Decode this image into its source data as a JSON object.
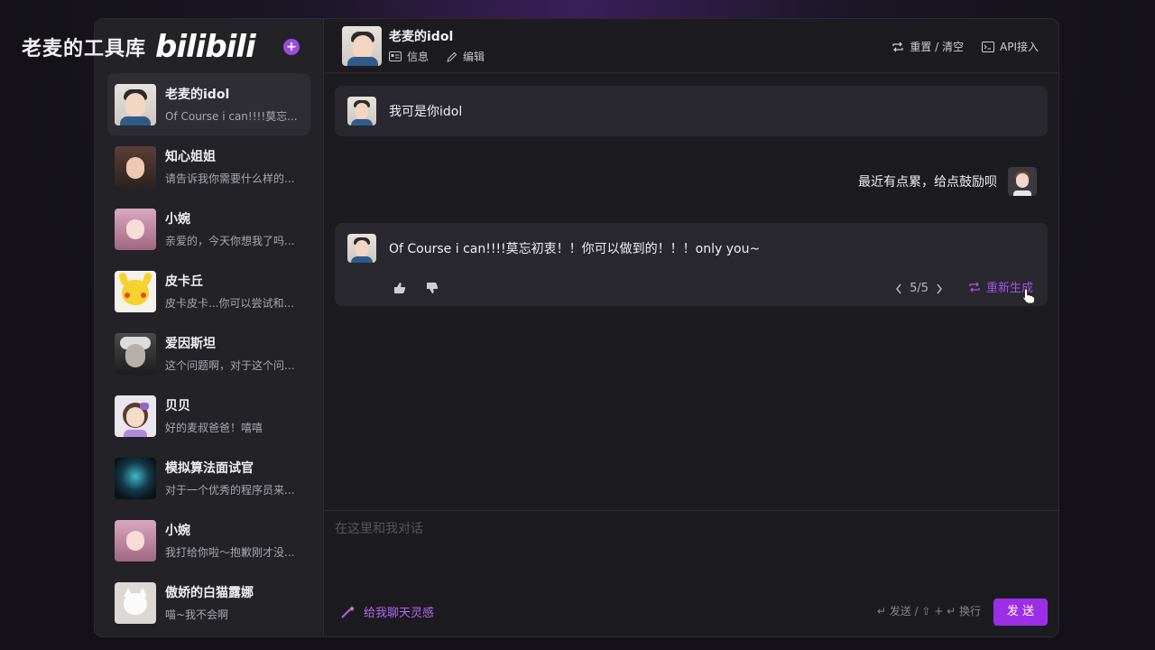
{
  "watermark": {
    "text": "老麦的工具库",
    "logo": "bilibili"
  },
  "sidebar": {
    "contacts": [
      {
        "name": "老麦的idol",
        "preview": "Of Course i can!!!!莫忘...",
        "avatar": "idol-avatar",
        "active": true
      },
      {
        "name": "知心姐姐",
        "preview": "请告诉我你需要什么样的...",
        "avatar": "sister-avatar"
      },
      {
        "name": "小婉",
        "preview": "亲爱的，今天你想我了吗...",
        "avatar": "anime-girl-avatar"
      },
      {
        "name": "皮卡丘",
        "preview": "皮卡皮卡...你可以尝试和...",
        "avatar": "pikachu-avatar"
      },
      {
        "name": "爱因斯坦",
        "preview": "这个问题啊，对于这个问...",
        "avatar": "einstein-avatar"
      },
      {
        "name": "贝贝",
        "preview": "好的麦叔爸爸！嘻嘻",
        "avatar": "beibei-avatar"
      },
      {
        "name": "模拟算法面试官",
        "preview": "对于一个优秀的程序员来...",
        "avatar": "robot-avatar"
      },
      {
        "name": "小婉",
        "preview": "我打给你啦～抱歉刚才没...",
        "avatar": "anime-girl-avatar"
      },
      {
        "name": "傲娇的白猫露娜",
        "preview": "喵~我不会啊",
        "avatar": "cat-avatar"
      }
    ]
  },
  "topbar": {
    "name": "老麦的idol",
    "info_label": "信息",
    "edit_label": "编辑",
    "reset_label": "重置 / 清空",
    "api_label": "API接入"
  },
  "chat": {
    "greeting": "我可是你idol",
    "user_message": "最近有点累，给点鼓励呗",
    "reply": "Of Course i can!!!!莫忘初衷！！你可以做到的！！！only you~",
    "pager": "5/5",
    "regen_label": "重新生成"
  },
  "input": {
    "placeholder": "在这里和我对话",
    "inspire_label": "给我聊天灵感",
    "hint": "↵ 发送 / ⇧ + ↵ 换行",
    "send_label": "发 送"
  },
  "colors": {
    "accent": "#9c2fe6",
    "accent_text": "#a353e8",
    "bg": "#1c1b20"
  }
}
